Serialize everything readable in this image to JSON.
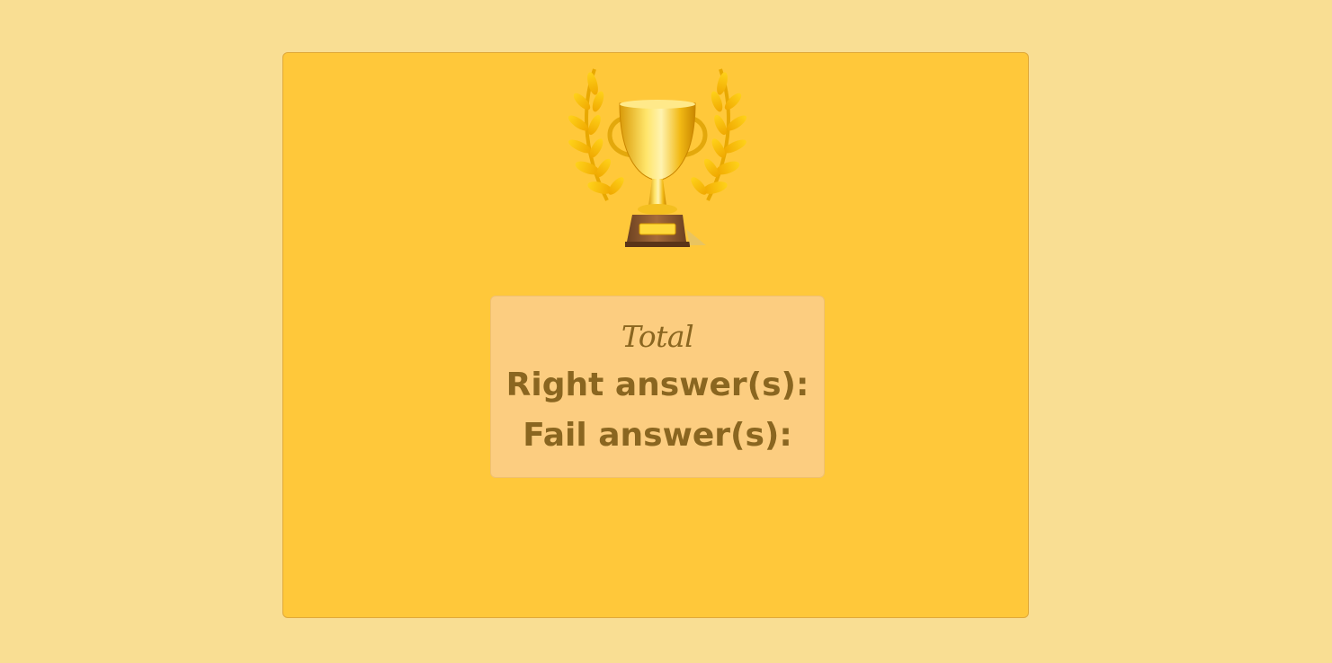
{
  "colors": {
    "page_background": "#f9de93",
    "card_background": "#ffc83a",
    "score_box_background": "#fccd80",
    "text": "#8a6620",
    "trophy_gold": "#f2c61a",
    "trophy_base": "#8a5a2e"
  },
  "trophy": {
    "icon": "trophy-with-laurel-icon"
  },
  "score": {
    "title": "Total",
    "right_label": "Right answer(s):",
    "fail_label": "Fail answer(s):"
  }
}
